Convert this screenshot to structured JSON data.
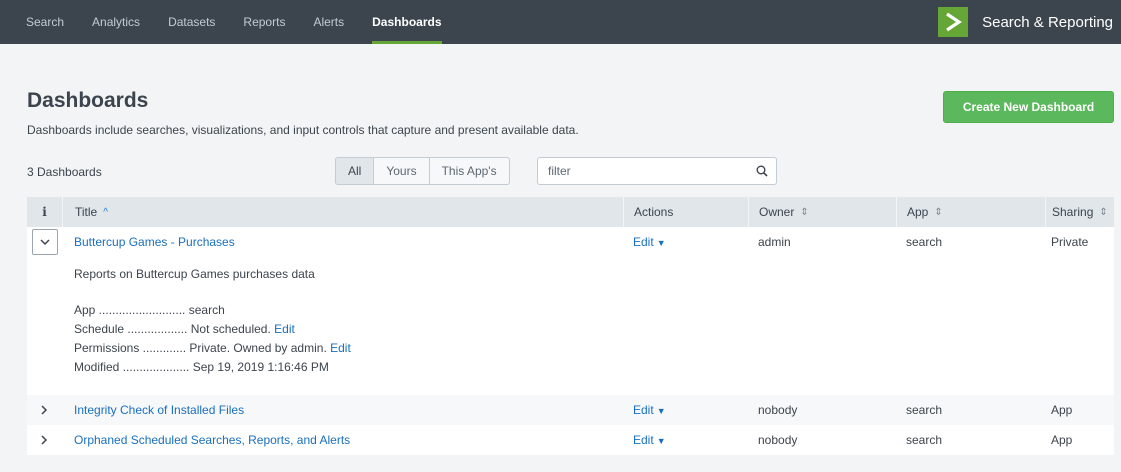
{
  "nav": {
    "items": [
      "Search",
      "Analytics",
      "Datasets",
      "Reports",
      "Alerts",
      "Dashboards"
    ],
    "active": "Dashboards"
  },
  "brand": {
    "name": "Search & Reporting",
    "accent": "#65a637"
  },
  "page": {
    "title": "Dashboards",
    "description": "Dashboards include searches, visualizations, and input controls that capture and present available data.",
    "create_button": "Create New Dashboard",
    "count": "3 Dashboards"
  },
  "filter": {
    "tabs": [
      "All",
      "Yours",
      "This App's"
    ],
    "selected": "All",
    "value": "filter",
    "placeholder": "filter"
  },
  "table": {
    "headers": {
      "info": "i",
      "title": "Title",
      "actions": "Actions",
      "owner": "Owner",
      "app": "App",
      "sharing": "Sharing"
    },
    "sort_asc": "^",
    "sort_both": "⇕",
    "rows": [
      {
        "title": "Buttercup Games - Purchases",
        "action": "Edit",
        "owner": "admin",
        "app": "search",
        "sharing": "Private",
        "expanded": true,
        "details": {
          "description": "Reports on Buttercup Games purchases data",
          "app_label": "App ..........................",
          "app_value": "search",
          "schedule_label": "Schedule ..................",
          "schedule_value": "Not scheduled.",
          "schedule_link": "Edit",
          "permissions_label": "Permissions .............",
          "permissions_value": "Private. Owned by admin.",
          "permissions_link": "Edit",
          "modified_label": "Modified ....................",
          "modified_value": "Sep 19, 2019 1:16:46 PM"
        }
      },
      {
        "title": "Integrity Check of Installed Files",
        "action": "Edit",
        "owner": "nobody",
        "app": "search",
        "sharing": "App",
        "expanded": false
      },
      {
        "title": "Orphaned Scheduled Searches, Reports, and Alerts",
        "action": "Edit",
        "owner": "nobody",
        "app": "search",
        "sharing": "App",
        "expanded": false
      }
    ]
  },
  "colors": {
    "topbar": "#3c444d",
    "accent_green": "#65a637",
    "button_green": "#5cb85c",
    "link_blue": "#1a6fbd",
    "background": "#f2f4f5"
  }
}
